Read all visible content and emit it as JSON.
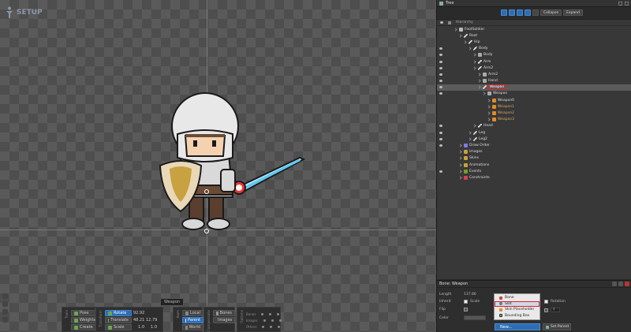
{
  "viewport": {
    "mode_label": "SETUP",
    "tooltip": "Weapon"
  },
  "toolbars": {
    "tools": {
      "title": "Tools",
      "buttons": [
        "Pose",
        "Weights",
        "Create"
      ]
    },
    "transform": {
      "title": "Transform",
      "rows": [
        {
          "label": "Rotate",
          "v1": "92.92",
          "v2": ""
        },
        {
          "label": "Translate",
          "v1": "48.21",
          "v2": "12.79"
        },
        {
          "label": "Scale",
          "v1": "1.0",
          "v2": "1.0"
        }
      ]
    },
    "axes": {
      "title": "Axes",
      "buttons": [
        "Local",
        "Parent",
        "World"
      ]
    },
    "compensate": {
      "title": "Compensate",
      "buttons": [
        "Bones",
        "Images"
      ]
    },
    "options": {
      "title": "Options",
      "rows": [
        "Bones",
        "Images",
        "Others"
      ]
    }
  },
  "tree": {
    "title": "Tree",
    "collapse_label": "Collapse",
    "expand_label": "Expand",
    "hierarchy_label": "Hierarchy",
    "rows": [
      {
        "label": "FootSoldier",
        "indent": 0,
        "icon": "root",
        "eye": false
      },
      {
        "label": "Root",
        "indent": 1,
        "icon": "bone",
        "eye": false
      },
      {
        "label": "Hip",
        "indent": 2,
        "icon": "bone",
        "eye": false
      },
      {
        "label": "Body",
        "indent": 3,
        "icon": "bone",
        "eye": true
      },
      {
        "label": "Body",
        "indent": 4,
        "icon": "slot",
        "eye": true
      },
      {
        "label": "Arm",
        "indent": 4,
        "icon": "bone",
        "eye": true
      },
      {
        "label": "Arm2",
        "indent": 4,
        "icon": "bone",
        "eye": true
      },
      {
        "label": "Arm2",
        "indent": 5,
        "icon": "slot",
        "eye": true
      },
      {
        "label": "Hand",
        "indent": 5,
        "icon": "slot",
        "eye": true
      },
      {
        "label": "Weapon",
        "indent": 5,
        "icon": "bone",
        "eye": true,
        "selected": true
      },
      {
        "label": "Weapon",
        "indent": 6,
        "icon": "slot",
        "eye": true
      },
      {
        "label": "Weapon0",
        "indent": 7,
        "icon": "att",
        "eye": false
      },
      {
        "label": "Weapon1",
        "indent": 7,
        "icon": "att",
        "eye": false,
        "dim": true
      },
      {
        "label": "Weapon2",
        "indent": 7,
        "icon": "att",
        "eye": false,
        "dim": true
      },
      {
        "label": "Weapon3",
        "indent": 7,
        "icon": "att",
        "eye": false,
        "dim": true
      },
      {
        "label": "Head",
        "indent": 4,
        "icon": "bone",
        "eye": true
      },
      {
        "label": "Leg",
        "indent": 3,
        "icon": "bone",
        "eye": true
      },
      {
        "label": "Leg2",
        "indent": 3,
        "icon": "bone",
        "eye": true
      },
      {
        "label": "Draw Order",
        "indent": 1,
        "icon": "draw",
        "eye": true
      },
      {
        "label": "Images",
        "indent": 1,
        "icon": "folder",
        "eye": false
      },
      {
        "label": "Skins",
        "indent": 1,
        "icon": "folder",
        "eye": false
      },
      {
        "label": "Animations",
        "indent": 1,
        "icon": "folder",
        "eye": false
      },
      {
        "label": "Events",
        "indent": 1,
        "icon": "ev",
        "eye": true
      },
      {
        "label": "Constraints",
        "indent": 1,
        "icon": "con",
        "eye": false
      }
    ]
  },
  "properties": {
    "title": "Bone: Weapon",
    "length_label": "Length",
    "length_value": "137.86",
    "inherit_label": "Inherit",
    "scale_label": "Scale",
    "rotation_label": "Rotation",
    "flip_label": "Flip",
    "color_label": "Color",
    "new_label": "New...",
    "set_parent_label": "Set Parent",
    "menu_items": [
      "Bone",
      "Slot",
      "Skin Placeholder",
      "Bounding Box"
    ]
  }
}
